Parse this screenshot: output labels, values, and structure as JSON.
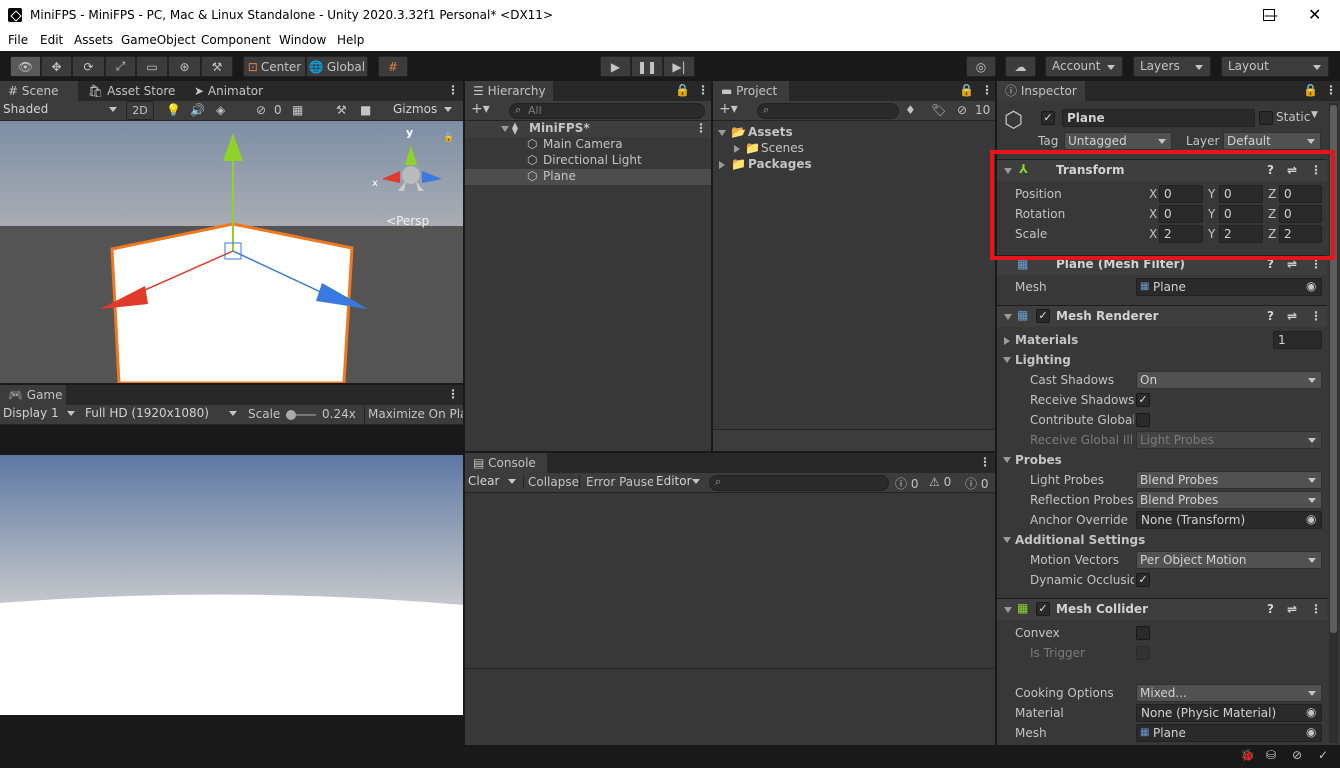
{
  "window": {
    "title": "MiniFPS - MiniFPS - PC, Mac & Linux Standalone - Unity 2020.3.32f1 Personal* <DX11>"
  },
  "menu": [
    "File",
    "Edit",
    "Assets",
    "GameObject",
    "Component",
    "Window",
    "Help"
  ],
  "toolbar": {
    "center": "Center",
    "global": "Global",
    "account": "Account",
    "layers": "Layers",
    "layout": "Layout"
  },
  "scene": {
    "tabs": [
      "Scene",
      "Asset Store",
      "Animator"
    ],
    "shading": "Shaded",
    "mode2d": "2D",
    "hidden_count": "0",
    "gizmos": "Gizmos",
    "persp": "Persp",
    "axis_y": "y",
    "axis_x": "x"
  },
  "game": {
    "tab": "Game",
    "display": "Display 1",
    "resolution": "Full HD (1920x1080)",
    "scale_label": "Scale",
    "scale_value": "0.24x",
    "maximize": "Maximize On Play"
  },
  "hierarchy": {
    "tab": "Hierarchy",
    "search_placeholder": "All",
    "scene": "MiniFPS*",
    "items": [
      "Main Camera",
      "Directional Light",
      "Plane"
    ]
  },
  "project": {
    "tab": "Project",
    "count": "10",
    "assets": "Assets",
    "scenes": "Scenes",
    "packages": "Packages"
  },
  "console": {
    "tab": "Console",
    "clear": "Clear",
    "collapse": "Collapse",
    "error_pause": "Error Pause",
    "editor": "Editor",
    "count_log": "0",
    "count_warn": "0",
    "count_err": "0"
  },
  "inspector": {
    "tab": "Inspector",
    "object_name": "Plane",
    "static": "Static",
    "tag_label": "Tag",
    "tag": "Untagged",
    "layer_label": "Layer",
    "layer": "Default",
    "transform": {
      "title": "Transform",
      "rows": [
        {
          "label": "Position",
          "x": "0",
          "y": "0",
          "z": "0"
        },
        {
          "label": "Rotation",
          "x": "0",
          "y": "0",
          "z": "0"
        },
        {
          "label": "Scale",
          "x": "2",
          "y": "2",
          "z": "2"
        }
      ]
    },
    "mesh_filter": {
      "title": "Plane (Mesh Filter)",
      "mesh_label": "Mesh",
      "mesh": "Plane"
    },
    "mesh_renderer": {
      "title": "Mesh Renderer",
      "materials_label": "Materials",
      "materials_count": "1",
      "lighting_label": "Lighting",
      "cast_shadows_label": "Cast Shadows",
      "cast_shadows": "On",
      "receive_shadows_label": "Receive Shadows",
      "contribute_gi_label": "Contribute Global I",
      "receive_gi_label": "Receive Global Illu",
      "receive_gi": "Light Probes",
      "probes_label": "Probes",
      "light_probes_label": "Light Probes",
      "light_probes": "Blend Probes",
      "reflection_probes_label": "Reflection Probes",
      "reflection_probes": "Blend Probes",
      "anchor_override_label": "Anchor Override",
      "anchor_override": "None (Transform)",
      "additional_label": "Additional Settings",
      "motion_vectors_label": "Motion Vectors",
      "motion_vectors": "Per Object Motion",
      "dynamic_occlusion_label": "Dynamic Occlusion"
    },
    "mesh_collider": {
      "title": "Mesh Collider",
      "convex_label": "Convex",
      "is_trigger_label": "Is Trigger",
      "cooking_label": "Cooking Options",
      "cooking": "Mixed...",
      "material_label": "Material",
      "material": "None (Physic Material)",
      "mesh_label": "Mesh",
      "mesh": "Plane"
    }
  },
  "colors": {
    "highlight": "#e8141c",
    "accent": "#3a72b0",
    "x_axis": "#e03a2a",
    "y_axis": "#8ed22a",
    "z_axis": "#3a7ae0",
    "selection": "#f07820"
  }
}
